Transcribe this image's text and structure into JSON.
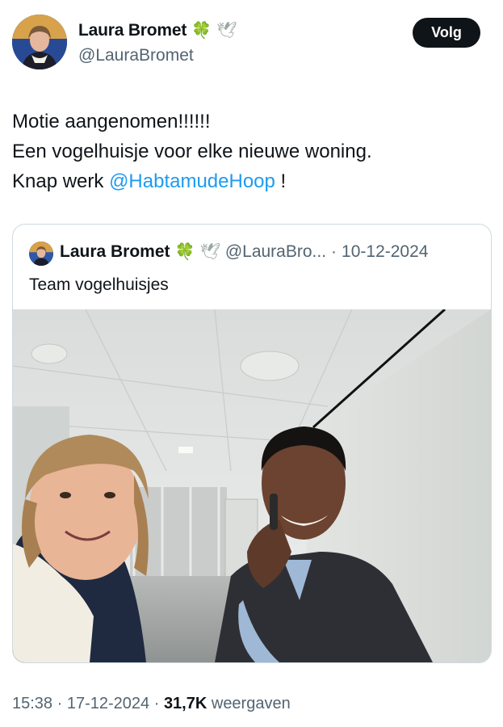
{
  "author": {
    "display_name": "Laura Bromet",
    "handle": "@LauraBromet",
    "emoji_1": "🍀",
    "emoji_2": "🕊"
  },
  "follow_label": "Volg",
  "tweet": {
    "line1": "Motie aangenomen!!!!!!",
    "line2": "Een vogelhuisje voor elke nieuwe woning.",
    "line3_prefix": "Knap werk ",
    "mention": "@HabtamudeHoop",
    "line3_suffix": " !"
  },
  "quote": {
    "display_name": "Laura Bromet",
    "emoji_1": "🍀",
    "emoji_2": "🕊",
    "handle": "@LauraBro...",
    "separator": "·",
    "date": "10-12-2024",
    "text": "Team vogelhuisjes"
  },
  "footer": {
    "time": "15:38",
    "sep1": " · ",
    "date": "17-12-2024",
    "sep2": " · ",
    "views": "31,7K",
    "views_label": " weergaven"
  },
  "colors": {
    "link": "#1d9bf0",
    "text": "#0f1419",
    "muted": "#536471",
    "button_bg": "#0f1419"
  }
}
